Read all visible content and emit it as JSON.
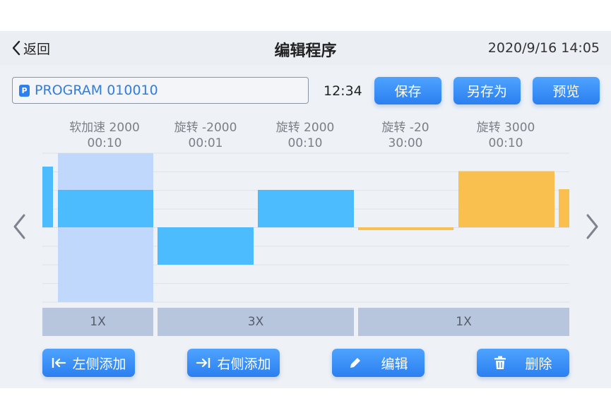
{
  "header": {
    "back_label": "返回",
    "title": "编辑程序",
    "datetime": "2020/9/16 14:05"
  },
  "program": {
    "badge": "P",
    "name": "PROGRAM 010010",
    "duration": "12:34"
  },
  "actions": {
    "save": "保存",
    "save_as": "另存为",
    "preview": "预览"
  },
  "segments": [
    {
      "line1": "软加速 2000",
      "line2": "00:10",
      "value": 2000,
      "color": "#4dbcff",
      "selected": true
    },
    {
      "line1": "旋转 -2000",
      "line2": "00:01",
      "value": -2000,
      "color": "#4dbcff",
      "selected": false
    },
    {
      "line1": "旋转 2000",
      "line2": "00:10",
      "value": 2000,
      "color": "#4dbcff",
      "selected": false
    },
    {
      "line1": "旋转 -20",
      "line2": "30:00",
      "value": -20,
      "color": "#fac04f",
      "selected": false
    },
    {
      "line1": "旋转 3000",
      "line2": "00:10",
      "value": 3000,
      "color": "#fac04f",
      "selected": false
    }
  ],
  "repeats": [
    "1X",
    "3X",
    "1X"
  ],
  "bottom": {
    "add_left": "左侧添加",
    "add_right": "右侧添加",
    "edit": "编辑",
    "delete": "删除"
  },
  "colors": {
    "accent": "#2e80f0",
    "blue_bar": "#4dbcff",
    "yellow_bar": "#fac04f",
    "selection": "#c0d8fb"
  }
}
